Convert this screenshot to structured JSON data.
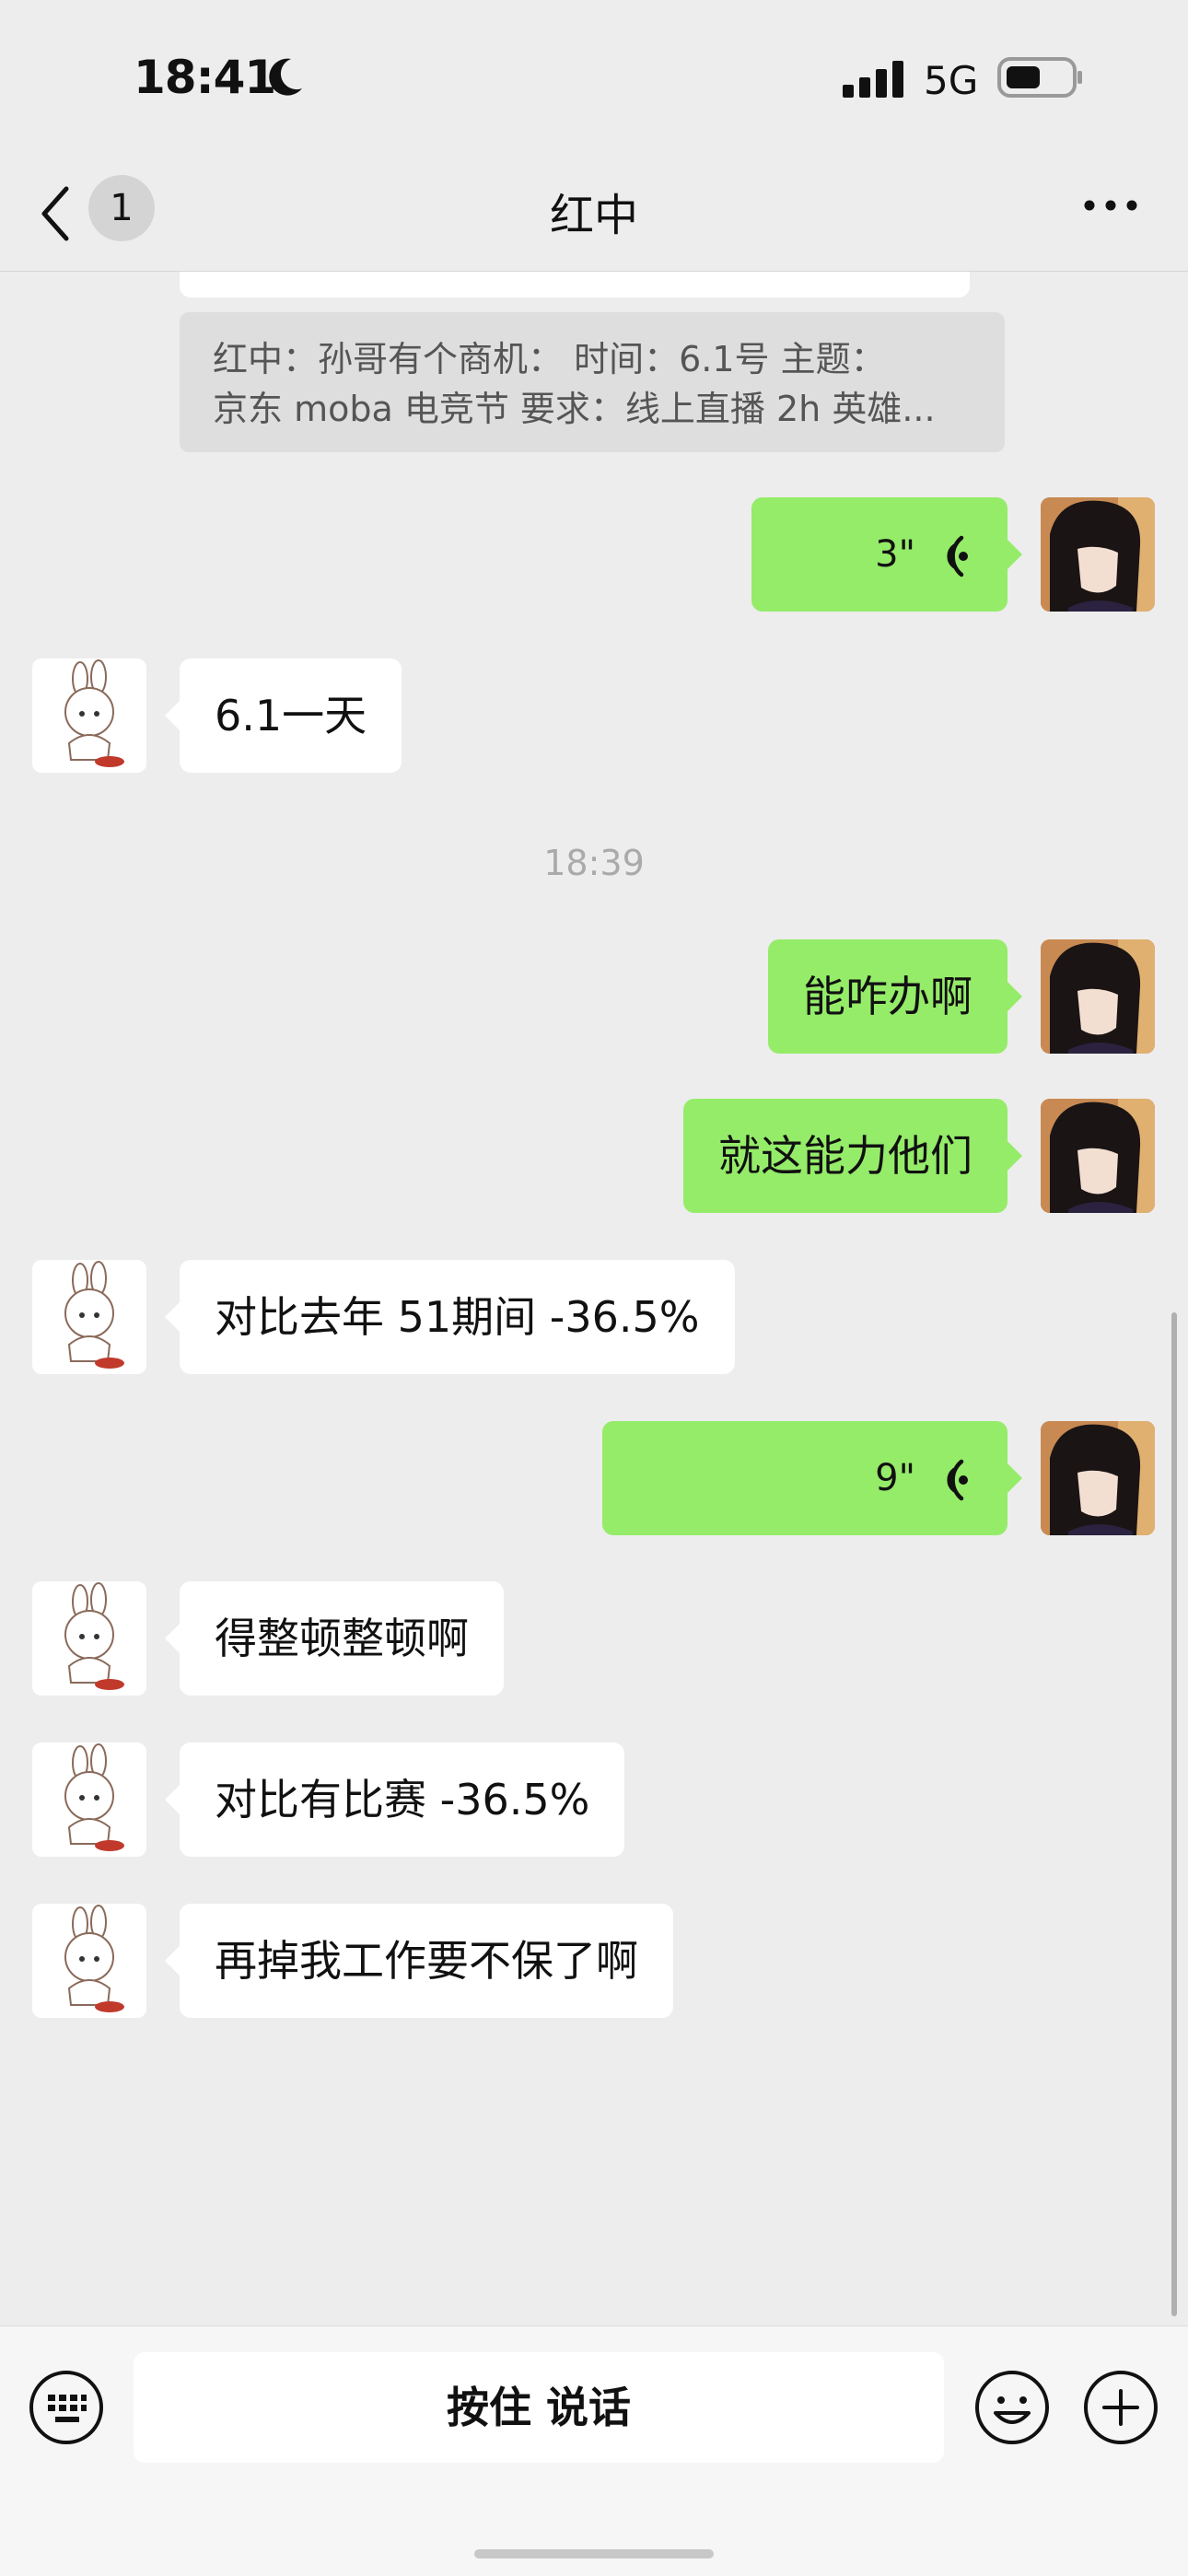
{
  "status": {
    "time": "18:41",
    "network": "5G"
  },
  "nav": {
    "badge": "1",
    "title": "红中"
  },
  "quote": {
    "line1": "红中：孙哥有个商机：  时间：6.1号   主题：",
    "line2": "京东 moba 电竞节   要求：线上直播 2h 英雄..."
  },
  "messages": {
    "m1": "3\"",
    "m2": "6.1一天",
    "ts": "18:39",
    "m3": "能咋办啊",
    "m4": "就这能力他们",
    "m5": "对比去年 51期间 -36.5%",
    "m6": "9\"",
    "m7": "得整顿整顿啊",
    "m8": "对比有比赛 -36.5%",
    "m9": "再掉我工作要不保了啊"
  },
  "input": {
    "ptt_label": "按住 说话"
  }
}
